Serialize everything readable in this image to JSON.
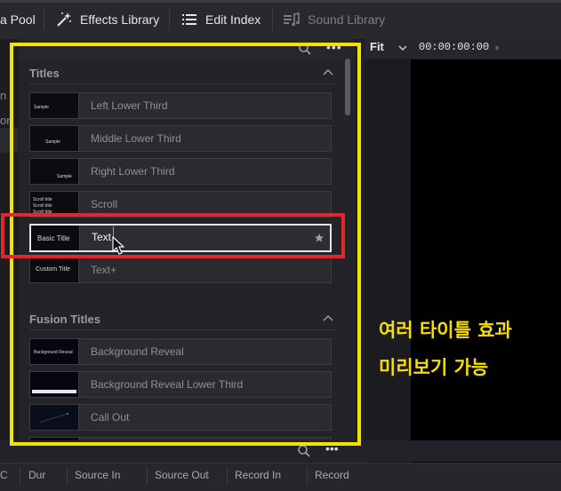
{
  "toolbar": {
    "media_pool_label": "a Pool",
    "effects_library_label": "Effects Library",
    "edit_index_label": "Edit Index",
    "sound_library_label": "Sound Library"
  },
  "left_strip": {
    "text_1": "n",
    "text_2": "on"
  },
  "viewer": {
    "zoom_label": "Fit",
    "timecode": "00:00:00:00"
  },
  "panel": {
    "sections": [
      {
        "title": "Titles",
        "items": [
          {
            "label": "Left Lower Third",
            "thumb": "Sample"
          },
          {
            "label": "Middle Lower Third",
            "thumb": "Sample"
          },
          {
            "label": "Right Lower Third",
            "thumb": "Sample"
          },
          {
            "label": "Scroll",
            "thumb": "Scroll title"
          },
          {
            "label": "Text",
            "thumb": "Basic Title"
          },
          {
            "label": "Text+",
            "thumb": "Custom Title"
          }
        ]
      },
      {
        "title": "Fusion Titles",
        "items": [
          {
            "label": "Background Reveal",
            "thumb": "Background Reveal"
          },
          {
            "label": "Background Reveal Lower Third",
            "thumb": ""
          },
          {
            "label": "Call Out",
            "thumb": ""
          }
        ]
      }
    ]
  },
  "columns": [
    "C",
    "Dur",
    "Source In",
    "Source Out",
    "Record In",
    "Record"
  ],
  "annotation": {
    "line_1": "여러 타이틀 효과",
    "line_2": "미리보기 가능"
  },
  "colors": {
    "highlight_yellow": "#f5e200",
    "highlight_red": "#e2262d",
    "panel_bg": "#232329"
  },
  "icons": [
    "effects-wand-icon",
    "edit-index-list-icon",
    "sound-library-icon",
    "search-icon",
    "more-options-icon",
    "chevron-up-icon",
    "chevron-down-icon",
    "favorite-star-icon",
    "mouse-cursor-icon"
  ]
}
